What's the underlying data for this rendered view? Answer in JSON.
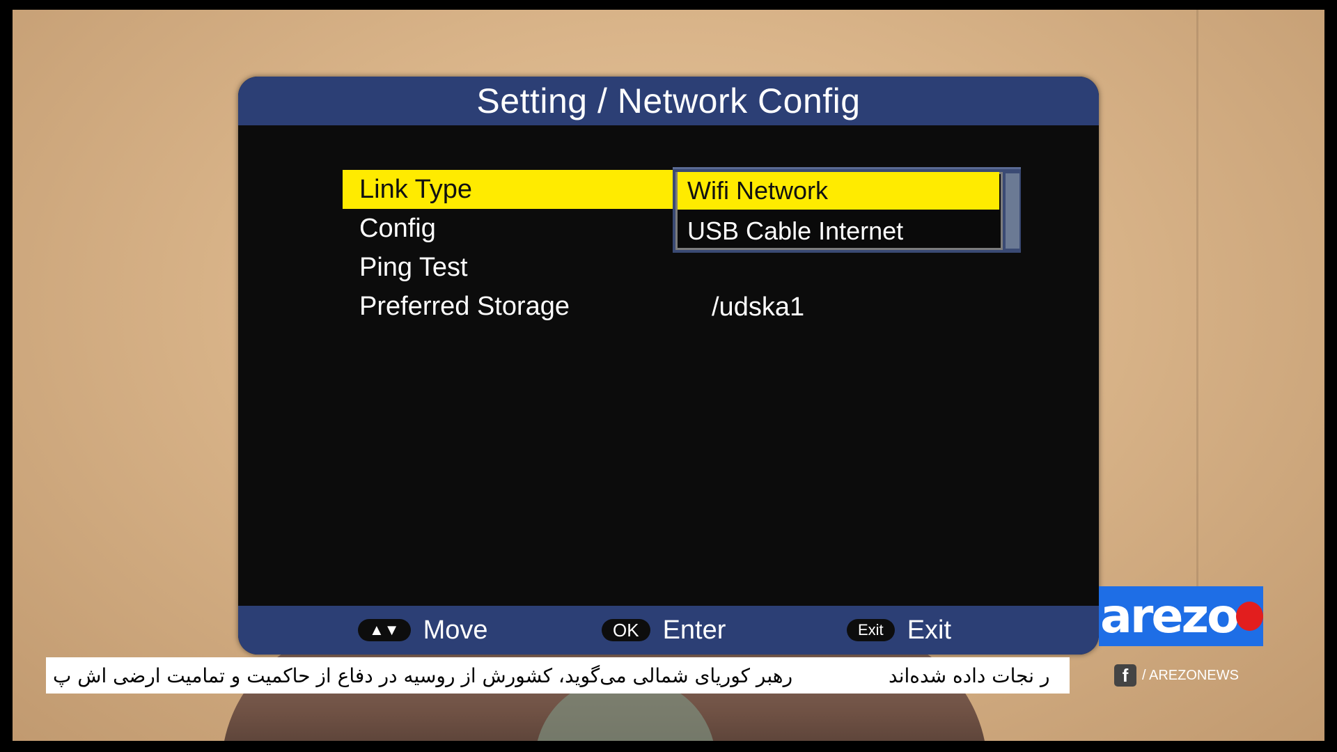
{
  "dialog": {
    "title": "Setting / Network Config"
  },
  "menu": {
    "items": [
      {
        "label": "Link Type",
        "value": "Wifi Network"
      },
      {
        "label": "Config",
        "value": ""
      },
      {
        "label": "Ping Test",
        "value": ""
      },
      {
        "label": "Preferred Storage",
        "value": "/udska1"
      }
    ]
  },
  "dropdown": {
    "options": [
      "Wifi Network",
      "USB Cable Internet"
    ],
    "selected": "Wifi Network"
  },
  "footer": {
    "hints": [
      {
        "key": "▲▼",
        "label": "Move"
      },
      {
        "key": "OK",
        "label": "Enter"
      },
      {
        "key": "Exit",
        "label": "Exit"
      }
    ]
  },
  "ticker": {
    "text_main": "رهبر کوریای شمالی می‌گوید، کشورش از روسیه در دفاع از حاکمیت و تمامیت ارضی اش پ",
    "text_tail": "ر نجات داده شده‌اند"
  },
  "branding": {
    "logo": "arezo",
    "social": "/ AREZONEWS",
    "social_icon": "facebook-icon"
  },
  "colors": {
    "header_blue": "#2c3f75",
    "highlight_yellow": "#ffeb00",
    "logo_blue": "#1e6ee6",
    "logo_red": "#e21e1e"
  }
}
